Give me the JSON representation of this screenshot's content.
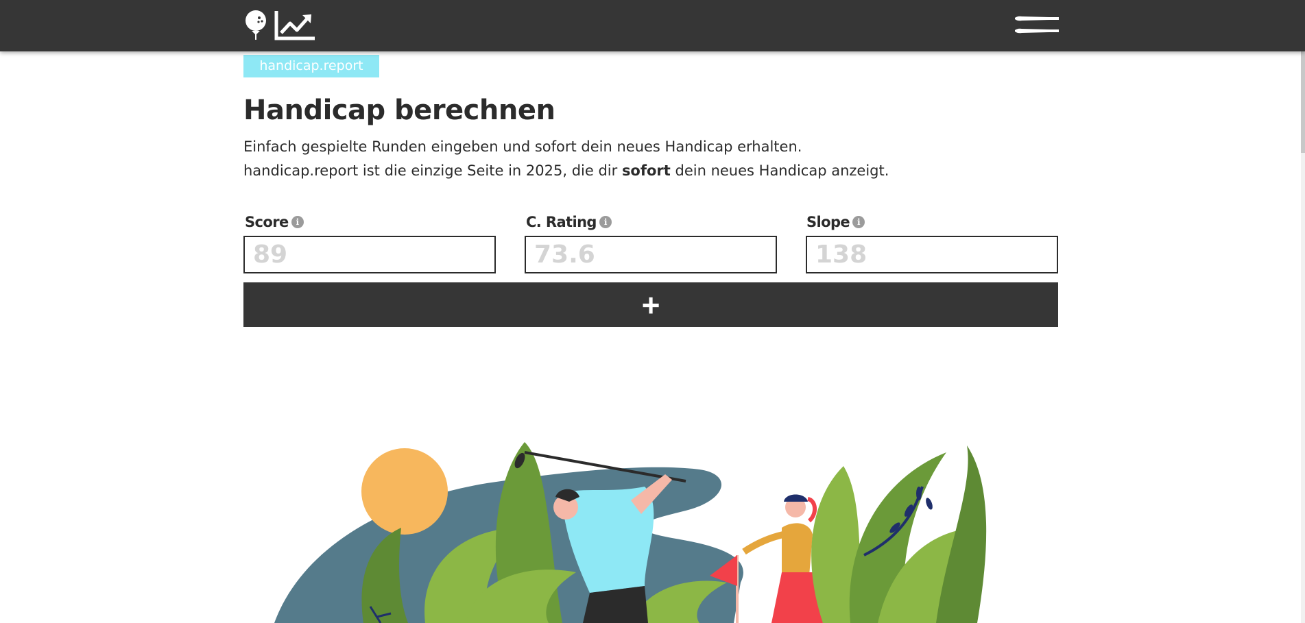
{
  "header": {
    "logo_icon": "golf-ball-chart-logo",
    "menu_icon": "golf-tees-menu-icon",
    "background_color": "#363636"
  },
  "badge": {
    "label": "handicap.report",
    "color": "#8ee8f5"
  },
  "page": {
    "title": "Handicap berechnen",
    "intro_line1": "Einfach gespielte Runden eingeben und sofort dein neues Handicap erhalten.",
    "intro_line2_prefix": "handicap.report ist die einzige Seite in 2025, die dir ",
    "intro_line2_bold": "sofort",
    "intro_line2_suffix": " dein neues Handicap anzeigt."
  },
  "form": {
    "score": {
      "label": "Score",
      "placeholder": "89",
      "info_icon": "info-icon"
    },
    "rating": {
      "label": "C. Rating",
      "placeholder": "73.6",
      "info_icon": "info-icon"
    },
    "slope": {
      "label": "Slope",
      "placeholder": "138",
      "info_icon": "info-icon"
    },
    "add_button": {
      "icon": "plus-icon",
      "label": "+"
    }
  },
  "illustration": {
    "name": "golfers-in-nature-illustration",
    "colors": {
      "sun": "#f7b75d",
      "lake": "#557b8b",
      "leaf": "#8cb746",
      "leaf_dark": "#6b9a39",
      "shirt": "#8ee8f5",
      "skirt": "#f2414a"
    }
  }
}
